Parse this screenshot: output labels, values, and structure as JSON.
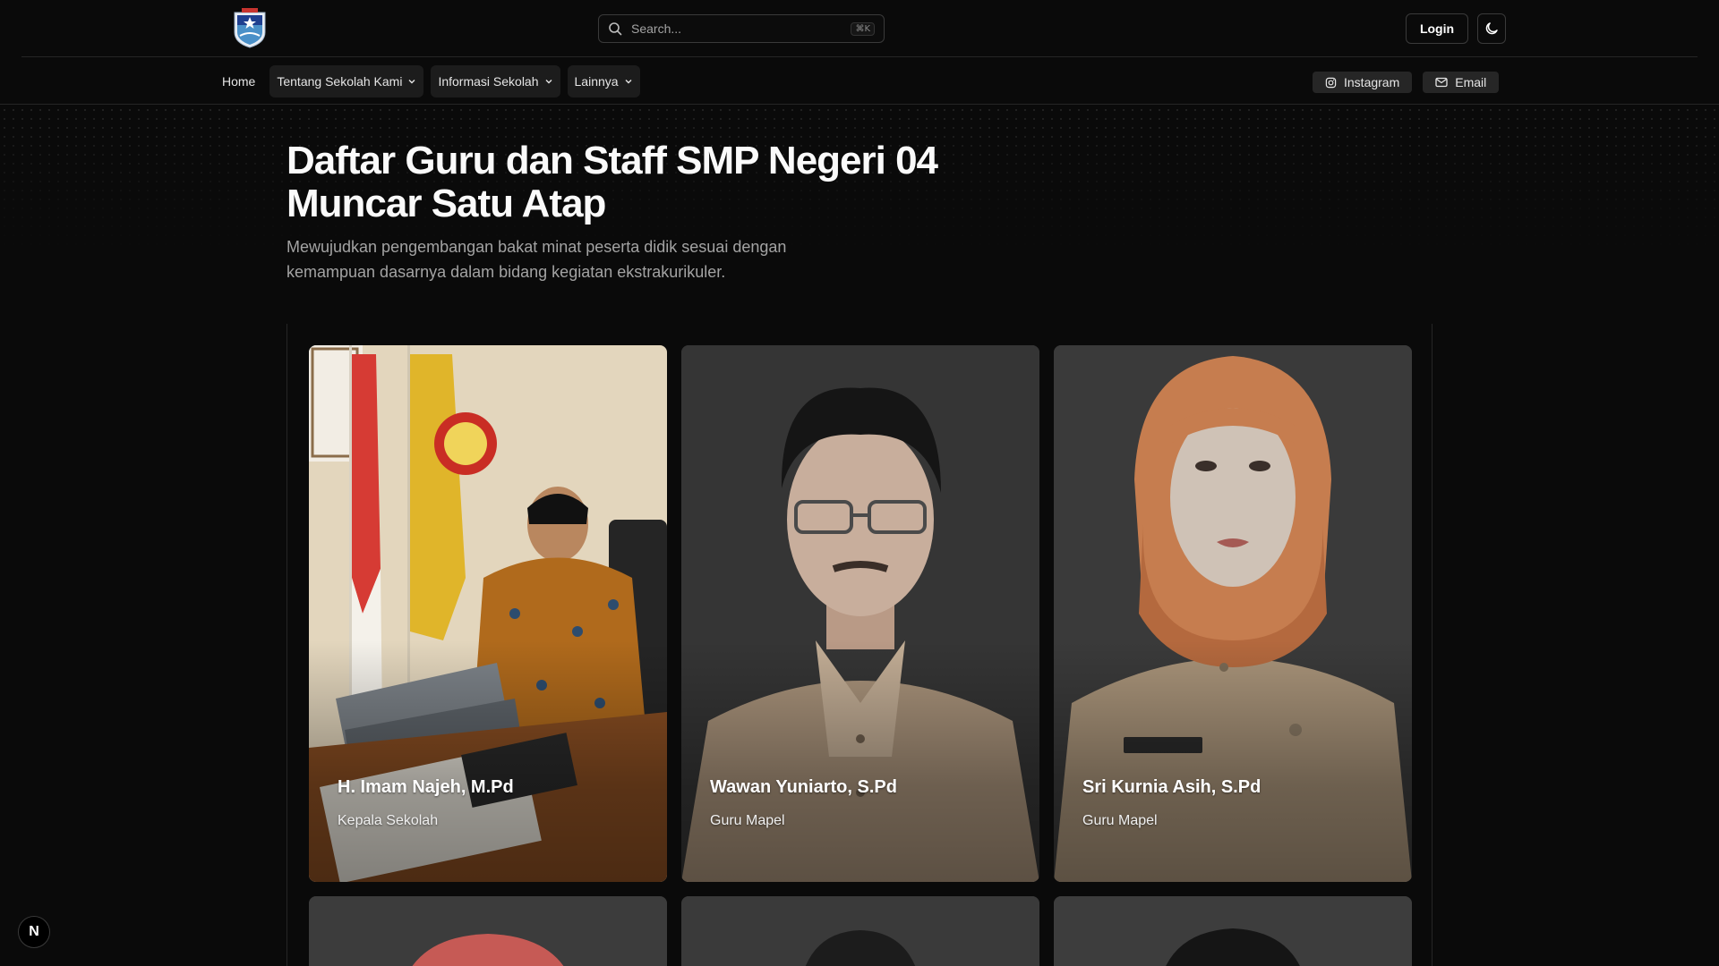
{
  "header": {
    "logo_icon": "school-crest-icon",
    "search": {
      "placeholder": "Search...",
      "shortcut": "⌘K"
    },
    "login_label": "Login",
    "theme_icon": "moon-icon"
  },
  "nav": {
    "items": [
      {
        "label": "Home",
        "has_menu": false
      },
      {
        "label": "Tentang Sekolah Kami",
        "has_menu": true
      },
      {
        "label": "Informasi Sekolah",
        "has_menu": true
      },
      {
        "label": "Lainnya",
        "has_menu": true
      }
    ],
    "links": [
      {
        "label": "Instagram",
        "icon": "instagram-icon"
      },
      {
        "label": "Email",
        "icon": "mail-icon"
      }
    ]
  },
  "hero": {
    "title_line1": "Daftar Guru dan Staff SMP Negeri 04",
    "title_line2": "Muncar Satu Atap",
    "subtitle": "Mewujudkan pengembangan bakat minat peserta didik sesuai dengan kemampuan dasarnya dalam bidang kegiatan ekstrakurikuler."
  },
  "staff": [
    {
      "name": "H. Imam Najeh, M.Pd",
      "role": "Kepala Sekolah"
    },
    {
      "name": "Wawan Yuniarto, S.Pd",
      "role": "Guru Mapel"
    },
    {
      "name": "Sri Kurnia Asih, S.Pd",
      "role": "Guru Mapel"
    },
    {
      "name": "",
      "role": ""
    },
    {
      "name": "",
      "role": ""
    },
    {
      "name": "",
      "role": ""
    }
  ],
  "framework_badge": "N",
  "colors": {
    "background": "#0a0a0a",
    "border": "#262626",
    "text": "#ededed",
    "muted": "#a3a3a3"
  }
}
